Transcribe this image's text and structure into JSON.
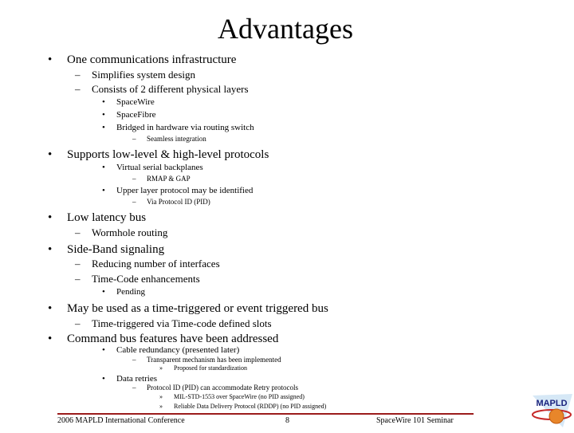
{
  "slide": {
    "title": "Advantages",
    "markers": {
      "bullet": "•",
      "dash": "–",
      "square": "▪",
      "chevron": "»"
    },
    "items": [
      {
        "level": 1,
        "marker": "•",
        "text": "One communications infrastructure"
      },
      {
        "level": 2,
        "marker": "–",
        "text": "Simplifies system design"
      },
      {
        "level": 2,
        "marker": "–",
        "text": "Consists of 2 different physical layers"
      },
      {
        "level": 3,
        "marker": "•",
        "text": "SpaceWire"
      },
      {
        "level": 3,
        "marker": "•",
        "text": "SpaceFibre"
      },
      {
        "level": 3,
        "marker": "•",
        "text": "Bridged in hardware via routing switch"
      },
      {
        "level": 4,
        "marker": "–",
        "text": "Seamless integration"
      },
      {
        "level": 1,
        "marker": "•",
        "text": "Supports low-level & high-level protocols"
      },
      {
        "level": 3,
        "marker": "•",
        "text": "Virtual serial backplanes"
      },
      {
        "level": 4,
        "marker": "–",
        "text": "RMAP & GAP"
      },
      {
        "level": 3,
        "marker": "•",
        "text": "Upper layer protocol may be identified"
      },
      {
        "level": 4,
        "marker": "–",
        "text": "Via Protocol ID (PID)"
      },
      {
        "level": 1,
        "marker": "•",
        "text": "Low latency bus"
      },
      {
        "level": 2,
        "marker": "–",
        "text": "Wormhole routing"
      },
      {
        "level": 1,
        "marker": "•",
        "text": "Side-Band signaling"
      },
      {
        "level": 2,
        "marker": "–",
        "text": "Reducing number of interfaces"
      },
      {
        "level": 2,
        "marker": "–",
        "text": "Time-Code enhancements"
      },
      {
        "level": 3,
        "marker": "•",
        "text": "Pending"
      },
      {
        "level": 1,
        "marker": "•",
        "text": "May be used as a time-triggered or event triggered bus"
      },
      {
        "level": 2,
        "marker": "–",
        "text": "Time-triggered via Time-code defined slots"
      },
      {
        "level": 1,
        "marker": "•",
        "text": "Command bus features have been addressed"
      },
      {
        "level": 3,
        "marker": "•",
        "text": "Cable redundancy (presented later)"
      },
      {
        "level": 4,
        "marker": "–",
        "text": "Transparent mechanism has been implemented"
      },
      {
        "level": 5,
        "marker": "»",
        "text": "Proposed for standardization"
      },
      {
        "level": 3,
        "marker": "•",
        "text": "Data retries"
      },
      {
        "level": 4,
        "marker": "–",
        "text": "Protocol ID (PID) can accommodate Retry protocols"
      },
      {
        "level": 5,
        "marker": "»",
        "text": "MIL-STD-1553 over SpaceWire (no PID assigned)"
      },
      {
        "level": 5,
        "marker": "»",
        "text": "Reliable Data Delivery Protocol (RDDP) (no PID assigned)"
      }
    ]
  },
  "footer": {
    "left": "2006 MAPLD International Conference",
    "center": "8",
    "right": "SpaceWire 101 Seminar"
  },
  "logo": {
    "text": "MAPLD"
  },
  "colors": {
    "rule": "#9b1c1c",
    "logo_planet": "#e8862a",
    "logo_bg": "#cfe3f3"
  }
}
